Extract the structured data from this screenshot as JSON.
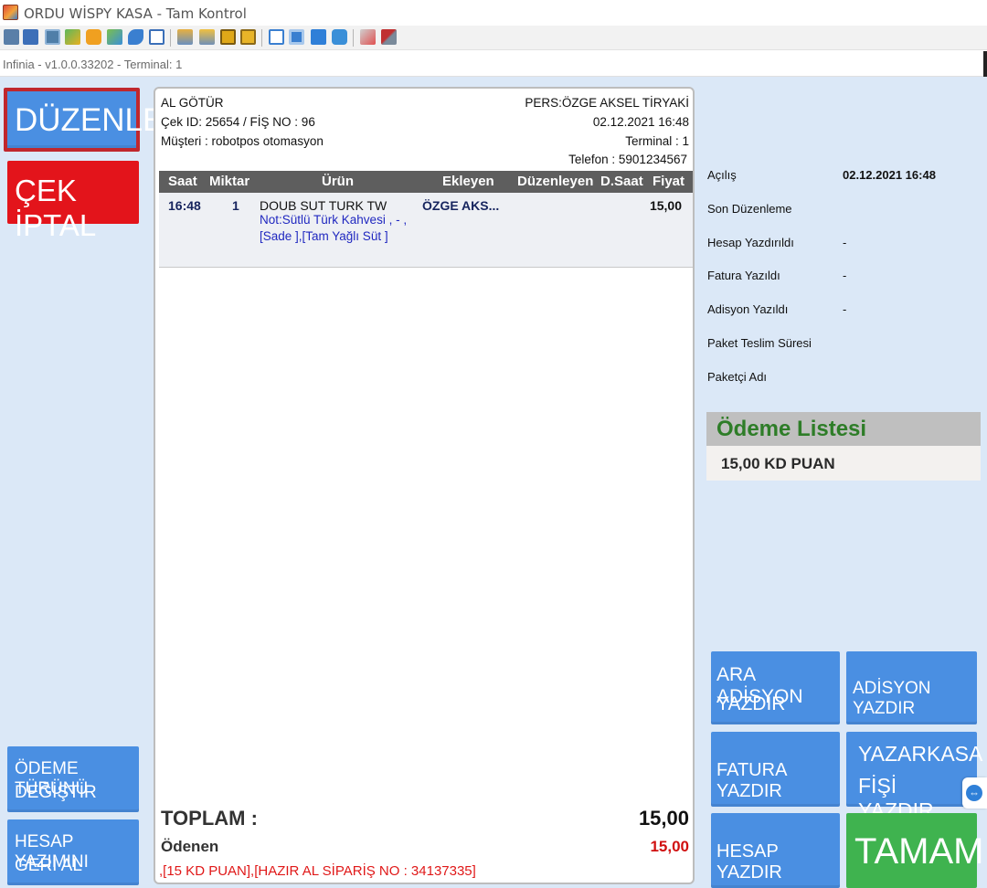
{
  "window": {
    "title": "ORDU WİSPY KASA - Tam Kontrol",
    "version_line": "Infinia - v1.0.0.33202 - Terminal: 1"
  },
  "toolbar": {
    "icons": [
      "pos-icon",
      "screen-icon",
      "terminal-icon",
      "transfer-icon",
      "clock-icon",
      "chat-icon",
      "phone-icon",
      "message-icon",
      "upload-icon",
      "network-icon",
      "lock-icon",
      "unlock-icon",
      "window-icon",
      "fullscreen-icon",
      "stop-icon",
      "refresh-icon",
      "copy-icon",
      "tools-icon"
    ]
  },
  "left_buttons": {
    "edit": "DÜZENLE",
    "cancel_check": "ÇEK İPTAL",
    "change_payment_line1": "ÖDEME TÜRÜNÜ",
    "change_payment_line2": "DEĞİŞTİR",
    "undo_print_line1": "HESAP YAZIMINI",
    "undo_print_line2": "GERİ AL"
  },
  "receipt": {
    "order_type": "AL GÖTÜR",
    "check_info": "Çek ID: 25654 / FİŞ NO : 96",
    "customer": "Müşteri : robotpos otomasyon",
    "staff": "PERS:ÖZGE AKSEL TİRYAKİ",
    "datetime": "02.12.2021 16:48",
    "terminal": "Terminal : 1",
    "phone": "Telefon : 5901234567",
    "columns": {
      "time": "Saat",
      "qty": "Miktar",
      "product": "Ürün",
      "added_by": "Ekleyen",
      "edited_by": "Düzenleyen",
      "edit_time": "D.Saat",
      "price": "Fiyat"
    },
    "items": [
      {
        "time": "16:48",
        "qty": "1",
        "product": "DOUB SUT TURK TW",
        "note_line1": "Not:Sütlü Türk Kahvesi , - ,",
        "note_line2": "[Sade ],[Tam Yağlı Süt ]",
        "added_by": "ÖZGE AKS...",
        "edited_by": "",
        "edit_time": "",
        "price": "15,00"
      }
    ],
    "total_label": "TOPLAM :",
    "total_value": "15,00",
    "paid_label": "Ödenen",
    "paid_value": "15,00",
    "footnote": ",[15 KD PUAN],[HAZIR AL SİPARİŞ NO : 34137335]"
  },
  "info": {
    "rows": [
      {
        "label": "Açılış",
        "value": "02.12.2021 16:48"
      },
      {
        "label": "Son Düzenleme",
        "value": ""
      },
      {
        "label": "Hesap Yazdırıldı",
        "value": "-"
      },
      {
        "label": "Fatura Yazıldı",
        "value": "-"
      },
      {
        "label": "Adisyon Yazıldı",
        "value": "-"
      },
      {
        "label": "Paket Teslim Süresi",
        "value": ""
      },
      {
        "label": "Paketçi Adı",
        "value": ""
      }
    ]
  },
  "payments": {
    "title": "Ödeme Listesi",
    "items": [
      "15,00 KD PUAN"
    ]
  },
  "action_buttons": {
    "interim_bill_line1": "ARA ADİSYON",
    "interim_bill_line2": "YAZDIR",
    "print_bill": "ADİSYON YAZDIR",
    "print_invoice": "FATURA YAZDIR",
    "fiscal_line1": "YAZARKASA",
    "fiscal_line2": "FİŞİ YAZDIR",
    "print_check": "HESAP YAZDIR",
    "ok": "TAMAM"
  },
  "colors": {
    "blue_button": "#4a8fe2",
    "red_button": "#e3141b",
    "green_button": "#3fb34f",
    "panel_bg": "#dbe8f7",
    "highlight_border": "#c0272d"
  }
}
